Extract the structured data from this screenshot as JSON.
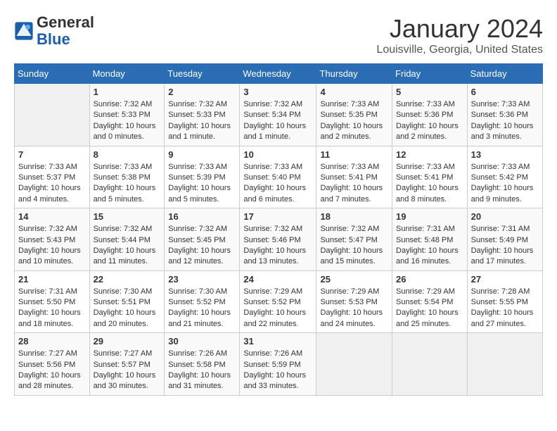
{
  "app": {
    "logo_general": "General",
    "logo_blue": "Blue",
    "title": "January 2024",
    "location": "Louisville, Georgia, United States"
  },
  "calendar": {
    "headers": [
      "Sunday",
      "Monday",
      "Tuesday",
      "Wednesday",
      "Thursday",
      "Friday",
      "Saturday"
    ],
    "weeks": [
      [
        {
          "day": "",
          "info": ""
        },
        {
          "day": "1",
          "info": "Sunrise: 7:32 AM\nSunset: 5:33 PM\nDaylight: 10 hours\nand 0 minutes."
        },
        {
          "day": "2",
          "info": "Sunrise: 7:32 AM\nSunset: 5:33 PM\nDaylight: 10 hours\nand 1 minute."
        },
        {
          "day": "3",
          "info": "Sunrise: 7:32 AM\nSunset: 5:34 PM\nDaylight: 10 hours\nand 1 minute."
        },
        {
          "day": "4",
          "info": "Sunrise: 7:33 AM\nSunset: 5:35 PM\nDaylight: 10 hours\nand 2 minutes."
        },
        {
          "day": "5",
          "info": "Sunrise: 7:33 AM\nSunset: 5:36 PM\nDaylight: 10 hours\nand 2 minutes."
        },
        {
          "day": "6",
          "info": "Sunrise: 7:33 AM\nSunset: 5:36 PM\nDaylight: 10 hours\nand 3 minutes."
        }
      ],
      [
        {
          "day": "7",
          "info": "Sunrise: 7:33 AM\nSunset: 5:37 PM\nDaylight: 10 hours\nand 4 minutes."
        },
        {
          "day": "8",
          "info": "Sunrise: 7:33 AM\nSunset: 5:38 PM\nDaylight: 10 hours\nand 5 minutes."
        },
        {
          "day": "9",
          "info": "Sunrise: 7:33 AM\nSunset: 5:39 PM\nDaylight: 10 hours\nand 5 minutes."
        },
        {
          "day": "10",
          "info": "Sunrise: 7:33 AM\nSunset: 5:40 PM\nDaylight: 10 hours\nand 6 minutes."
        },
        {
          "day": "11",
          "info": "Sunrise: 7:33 AM\nSunset: 5:41 PM\nDaylight: 10 hours\nand 7 minutes."
        },
        {
          "day": "12",
          "info": "Sunrise: 7:33 AM\nSunset: 5:41 PM\nDaylight: 10 hours\nand 8 minutes."
        },
        {
          "day": "13",
          "info": "Sunrise: 7:33 AM\nSunset: 5:42 PM\nDaylight: 10 hours\nand 9 minutes."
        }
      ],
      [
        {
          "day": "14",
          "info": "Sunrise: 7:32 AM\nSunset: 5:43 PM\nDaylight: 10 hours\nand 10 minutes."
        },
        {
          "day": "15",
          "info": "Sunrise: 7:32 AM\nSunset: 5:44 PM\nDaylight: 10 hours\nand 11 minutes."
        },
        {
          "day": "16",
          "info": "Sunrise: 7:32 AM\nSunset: 5:45 PM\nDaylight: 10 hours\nand 12 minutes."
        },
        {
          "day": "17",
          "info": "Sunrise: 7:32 AM\nSunset: 5:46 PM\nDaylight: 10 hours\nand 13 minutes."
        },
        {
          "day": "18",
          "info": "Sunrise: 7:32 AM\nSunset: 5:47 PM\nDaylight: 10 hours\nand 15 minutes."
        },
        {
          "day": "19",
          "info": "Sunrise: 7:31 AM\nSunset: 5:48 PM\nDaylight: 10 hours\nand 16 minutes."
        },
        {
          "day": "20",
          "info": "Sunrise: 7:31 AM\nSunset: 5:49 PM\nDaylight: 10 hours\nand 17 minutes."
        }
      ],
      [
        {
          "day": "21",
          "info": "Sunrise: 7:31 AM\nSunset: 5:50 PM\nDaylight: 10 hours\nand 18 minutes."
        },
        {
          "day": "22",
          "info": "Sunrise: 7:30 AM\nSunset: 5:51 PM\nDaylight: 10 hours\nand 20 minutes."
        },
        {
          "day": "23",
          "info": "Sunrise: 7:30 AM\nSunset: 5:52 PM\nDaylight: 10 hours\nand 21 minutes."
        },
        {
          "day": "24",
          "info": "Sunrise: 7:29 AM\nSunset: 5:52 PM\nDaylight: 10 hours\nand 22 minutes."
        },
        {
          "day": "25",
          "info": "Sunrise: 7:29 AM\nSunset: 5:53 PM\nDaylight: 10 hours\nand 24 minutes."
        },
        {
          "day": "26",
          "info": "Sunrise: 7:29 AM\nSunset: 5:54 PM\nDaylight: 10 hours\nand 25 minutes."
        },
        {
          "day": "27",
          "info": "Sunrise: 7:28 AM\nSunset: 5:55 PM\nDaylight: 10 hours\nand 27 minutes."
        }
      ],
      [
        {
          "day": "28",
          "info": "Sunrise: 7:27 AM\nSunset: 5:56 PM\nDaylight: 10 hours\nand 28 minutes."
        },
        {
          "day": "29",
          "info": "Sunrise: 7:27 AM\nSunset: 5:57 PM\nDaylight: 10 hours\nand 30 minutes."
        },
        {
          "day": "30",
          "info": "Sunrise: 7:26 AM\nSunset: 5:58 PM\nDaylight: 10 hours\nand 31 minutes."
        },
        {
          "day": "31",
          "info": "Sunrise: 7:26 AM\nSunset: 5:59 PM\nDaylight: 10 hours\nand 33 minutes."
        },
        {
          "day": "",
          "info": ""
        },
        {
          "day": "",
          "info": ""
        },
        {
          "day": "",
          "info": ""
        }
      ]
    ]
  }
}
